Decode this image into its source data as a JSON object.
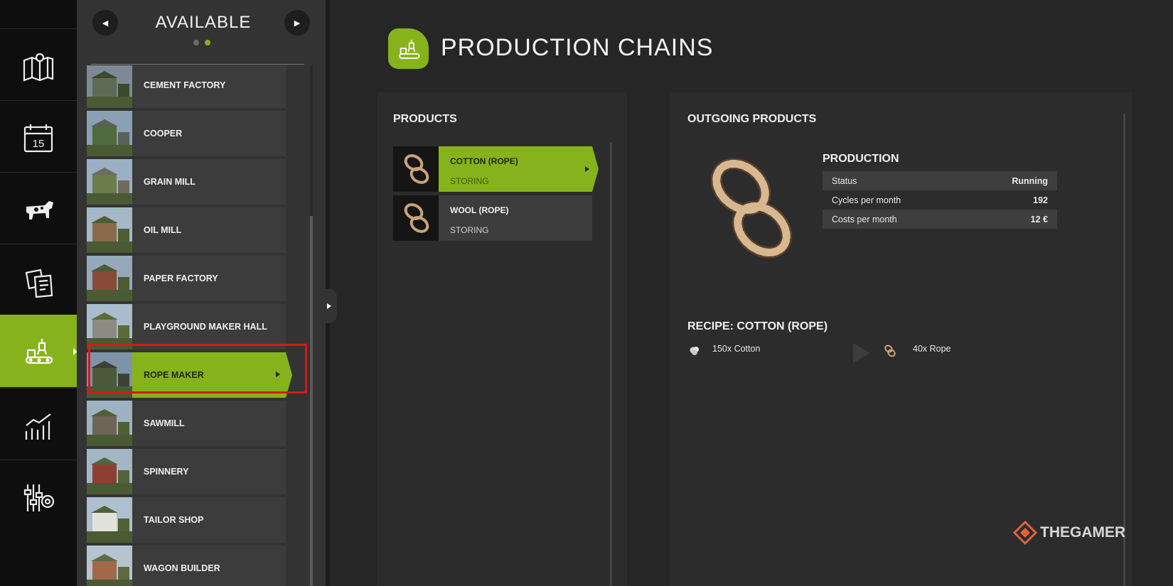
{
  "available": {
    "title": "AVAILABLE",
    "prev_label": "◀",
    "next_label": "▶"
  },
  "list": [
    {
      "label": "CEMENT FACTORY"
    },
    {
      "label": "COOPER"
    },
    {
      "label": "GRAIN MILL"
    },
    {
      "label": "OIL MILL"
    },
    {
      "label": "PAPER FACTORY"
    },
    {
      "label": "PLAYGROUND MAKER HALL"
    },
    {
      "label": "ROPE MAKER",
      "selected": true
    },
    {
      "label": "SAWMILL"
    },
    {
      "label": "SPINNERY"
    },
    {
      "label": "TAILOR SHOP"
    },
    {
      "label": "WAGON BUILDER"
    }
  ],
  "rail": [
    "map-icon",
    "calendar-icon",
    "animals-icon",
    "contracts-icon",
    "production-icon",
    "statistics-icon",
    "settings-icon"
  ],
  "rail_calendar_day": "15",
  "main": {
    "title": "PRODUCTION CHAINS"
  },
  "products": {
    "title": "PRODUCTS",
    "items": [
      {
        "name": "COTTON (ROPE)",
        "status": "STORING",
        "selected": true
      },
      {
        "name": "WOOL (ROPE)",
        "status": "STORING"
      }
    ]
  },
  "outgoing": {
    "title": "OUTGOING PRODUCTS",
    "production_title": "PRODUCTION",
    "stats": [
      {
        "label": "Status",
        "value": "Running"
      },
      {
        "label": "Cycles per month",
        "value": "192"
      },
      {
        "label": "Costs per month",
        "value": "12 €"
      }
    ],
    "recipe_title": "RECIPE: COTTON (ROPE)",
    "input": "150x Cotton",
    "output": "40x Rope"
  },
  "watermark": "THEGAMER",
  "colors": {
    "accent": "#86b31b",
    "highlight": "#d31a1a"
  }
}
